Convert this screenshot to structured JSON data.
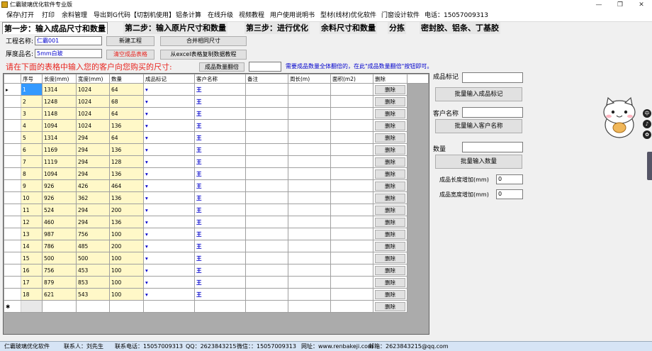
{
  "window": {
    "title": "仁霸玻璃优化软件专业版",
    "minimize": "—",
    "maximize": "❐",
    "close": "✕"
  },
  "menu": [
    {
      "label": "保存\\打开"
    },
    {
      "label": "打印"
    },
    {
      "label": "余料管理"
    },
    {
      "label": "导出到G代码【切割机使用】"
    },
    {
      "label": "铝条计算"
    },
    {
      "label": "在线升级"
    },
    {
      "label": "视频教程"
    },
    {
      "label": "用户使用说明书"
    },
    {
      "label": "型材(线材)优化软件"
    },
    {
      "label": "门窗设计软件"
    },
    {
      "label": "电话：15057009313"
    }
  ],
  "steps": {
    "step1": "第一步：输入成品尺寸和数量",
    "step2": "第二步：输入原片尺寸和数量",
    "step3": "第三步：进行优化",
    "remnant": "余料尺寸和数量",
    "split": "分拣",
    "sealant": "密封胶、铝条、丁基胶"
  },
  "project": {
    "name_label": "工程名称:",
    "name_value": "仁霸001",
    "thickness_label": "厚度品名:",
    "thickness_value": "5mm白玻",
    "new_project": "新建工程",
    "merge_sizes": "合并相同尺寸",
    "clear_table": "清空成品表格",
    "excel_tutorial": "从excel表格复制数据教程"
  },
  "instruction": "请在下面的表格中输入您的客户向您购买的尺寸:",
  "flip": {
    "button": "成品数量翻倍",
    "value": "",
    "hint": "需要成品数量全体翻倍的，在此\"成品数量翻倍\"按钮即可。"
  },
  "grid": {
    "columns": [
      "序号",
      "长度(mm)",
      "宽度(mm)",
      "数量",
      "成品标记",
      "客户名称",
      "备注",
      "周长(m)",
      "面积(m2)",
      "删除"
    ],
    "delete_label": "删除",
    "rows": [
      {
        "seq": "1",
        "length": "1314",
        "width": "1024",
        "qty": "64",
        "mark": "▾",
        "customer": "王"
      },
      {
        "seq": "2",
        "length": "1248",
        "width": "1024",
        "qty": "68",
        "mark": "▾",
        "customer": "王"
      },
      {
        "seq": "3",
        "length": "1148",
        "width": "1024",
        "qty": "64",
        "mark": "▾",
        "customer": "王"
      },
      {
        "seq": "4",
        "length": "1094",
        "width": "1024",
        "qty": "136",
        "mark": "▾",
        "customer": "王"
      },
      {
        "seq": "5",
        "length": "1314",
        "width": "294",
        "qty": "64",
        "mark": "▾",
        "customer": "王"
      },
      {
        "seq": "6",
        "length": "1169",
        "width": "294",
        "qty": "136",
        "mark": "▾",
        "customer": "王"
      },
      {
        "seq": "7",
        "length": "1119",
        "width": "294",
        "qty": "128",
        "mark": "▾",
        "customer": "王"
      },
      {
        "seq": "8",
        "length": "1094",
        "width": "294",
        "qty": "136",
        "mark": "▾",
        "customer": "王"
      },
      {
        "seq": "9",
        "length": "926",
        "width": "426",
        "qty": "464",
        "mark": "▾",
        "customer": "王"
      },
      {
        "seq": "10",
        "length": "926",
        "width": "362",
        "qty": "136",
        "mark": "▾",
        "customer": "王"
      },
      {
        "seq": "11",
        "length": "524",
        "width": "294",
        "qty": "200",
        "mark": "▾",
        "customer": "王"
      },
      {
        "seq": "12",
        "length": "460",
        "width": "294",
        "qty": "136",
        "mark": "▾",
        "customer": "王"
      },
      {
        "seq": "13",
        "length": "987",
        "width": "756",
        "qty": "100",
        "mark": "▾",
        "customer": "王"
      },
      {
        "seq": "14",
        "length": "786",
        "width": "485",
        "qty": "200",
        "mark": "▾",
        "customer": "王"
      },
      {
        "seq": "15",
        "length": "500",
        "width": "500",
        "qty": "100",
        "mark": "▾",
        "customer": "王"
      },
      {
        "seq": "16",
        "length": "756",
        "width": "453",
        "qty": "100",
        "mark": "▾",
        "customer": "王"
      },
      {
        "seq": "17",
        "length": "879",
        "width": "853",
        "qty": "100",
        "mark": "▾",
        "customer": "王"
      },
      {
        "seq": "18",
        "length": "621",
        "width": "543",
        "qty": "100",
        "mark": "▾",
        "customer": "王"
      }
    ],
    "current_row_marker": "▸",
    "new_row_marker": "✱"
  },
  "right_panel": {
    "mark_label": "成品标记",
    "mark_value": "",
    "batch_mark": "批量输入成品标记",
    "customer_label": "客户名称",
    "customer_value": "",
    "batch_customer": "批量输入客户名称",
    "qty_label": "数量",
    "qty_value": "",
    "batch_qty": "批量输入数量",
    "len_add_label": "成品长度增加(mm)",
    "len_add_value": "0",
    "wid_add_label": "成品宽度增加(mm)",
    "wid_add_value": "0"
  },
  "side_icons": [
    "中",
    "♪",
    "✿"
  ],
  "statusbar": {
    "app": "仁霸玻璃优化软件",
    "contact": "联系人：刘先生",
    "phone": "联系电话：15057009313",
    "qq": "QQ：2623843215",
    "wechat": "微信：：15057009313",
    "website": "网址：www.renbakeji.com",
    "email": "邮箱：2623843215@qq.com"
  },
  "colors": {
    "heading_red": "#e8251f",
    "step_bg": "#e6e6e6",
    "accent_blue": "#0000cc",
    "selection": "#3399ff",
    "number_cell": "#fff8c8"
  }
}
